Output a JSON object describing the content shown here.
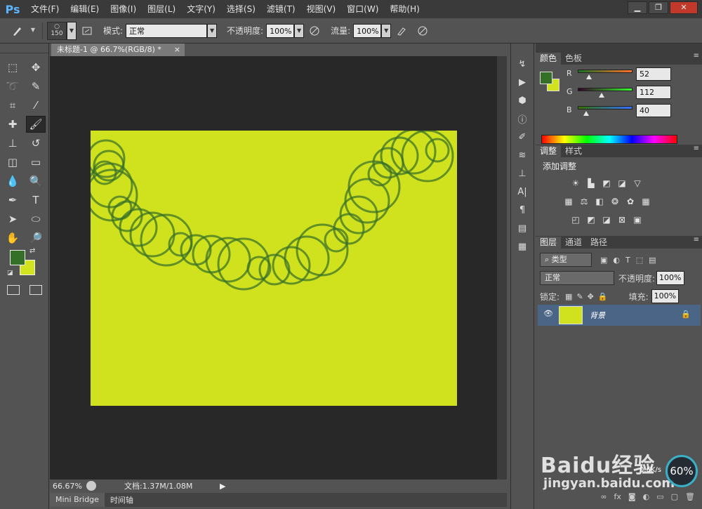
{
  "app": {
    "logo": "Ps"
  },
  "menu": [
    "文件(F)",
    "编辑(E)",
    "图像(I)",
    "图层(L)",
    "文字(Y)",
    "选择(S)",
    "滤镜(T)",
    "视图(V)",
    "窗口(W)",
    "帮助(H)"
  ],
  "window_controls": {
    "minimize": "▁",
    "restore": "❐",
    "close": "✕"
  },
  "options": {
    "brush_size": "150",
    "mode_label": "模式:",
    "mode_value": "正常",
    "opacity_label": "不透明度:",
    "opacity_value": "100%",
    "flow_label": "流量:",
    "flow_value": "100%"
  },
  "document": {
    "tab_title": "未标题-1 @ 66.7%(RGB/8) *",
    "tab_close": "×",
    "canvas_color": "#d0e21e",
    "stroke_color": "#346e28"
  },
  "status": {
    "zoom": "66.67%",
    "doc_info": "文档:1.37M/1.08M"
  },
  "bottom_tabs": [
    "Mini Bridge",
    "时间轴"
  ],
  "color_panel": {
    "tabs": [
      "颜色",
      "色板"
    ],
    "foreground": "#347028",
    "background": "#d2e21e",
    "r_label": "R",
    "r_value": "52",
    "g_label": "G",
    "g_value": "112",
    "b_label": "B",
    "b_value": "40"
  },
  "adjust_panel": {
    "tabs": [
      "调整",
      "样式"
    ],
    "title": "添加调整"
  },
  "layers_panel": {
    "tabs": [
      "图层",
      "通道",
      "路径"
    ],
    "filter_kind": "类型",
    "blend_mode": "正常",
    "opacity_label": "不透明度:",
    "opacity_value": "100%",
    "lock_label": "锁定:",
    "fill_label": "填充:",
    "fill_value": "100%",
    "layer_name": "背景",
    "footer_icons": [
      "link-icon",
      "fx-icon",
      "mask-icon",
      "adjustment-icon",
      "folder-icon",
      "new-layer-icon",
      "trash-icon"
    ]
  },
  "watermark": {
    "logo": "Baidu经验",
    "url": "jingyan.baidu.com",
    "badge": "60%",
    "speed": "0.6K/s"
  }
}
